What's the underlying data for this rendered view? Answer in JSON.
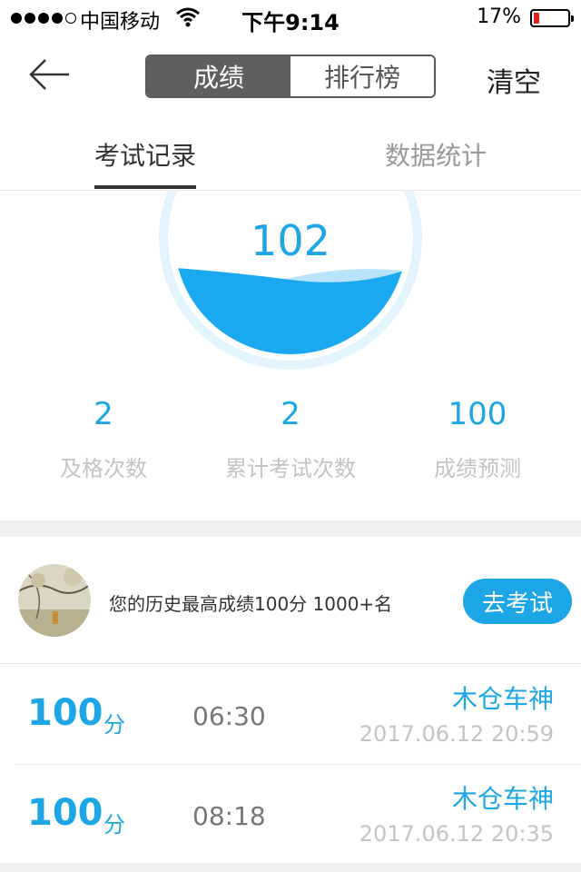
{
  "status_bar": {
    "carrier": "中国移动",
    "time": "下午9:14",
    "battery_percent": "17%",
    "battery_level": 0.17,
    "battery_color": "#e0221f"
  },
  "nav": {
    "back_icon": "back-arrow-icon",
    "segments": [
      "成绩",
      "排行榜"
    ],
    "active_segment": 0,
    "clear_label": "清空"
  },
  "tabs": {
    "items": [
      "考试记录",
      "数据统计"
    ],
    "active": 0
  },
  "gauge": {
    "score": "102",
    "accent": "#1aa8f0"
  },
  "stats": [
    {
      "value": "2",
      "label": "及格次数"
    },
    {
      "value": "2",
      "label": "累计考试次数"
    },
    {
      "value": "100",
      "label": "成绩预测"
    }
  ],
  "best": {
    "text": "您的历史最高成绩100分  1000+名",
    "button_label": "去考试"
  },
  "records": [
    {
      "score": "100",
      "unit": "分",
      "duration": "06:30",
      "name": "木仓车神",
      "date": "2017.06.12 20:59"
    },
    {
      "score": "100",
      "unit": "分",
      "duration": "08:18",
      "name": "木仓车神",
      "date": "2017.06.12 20:35"
    }
  ]
}
